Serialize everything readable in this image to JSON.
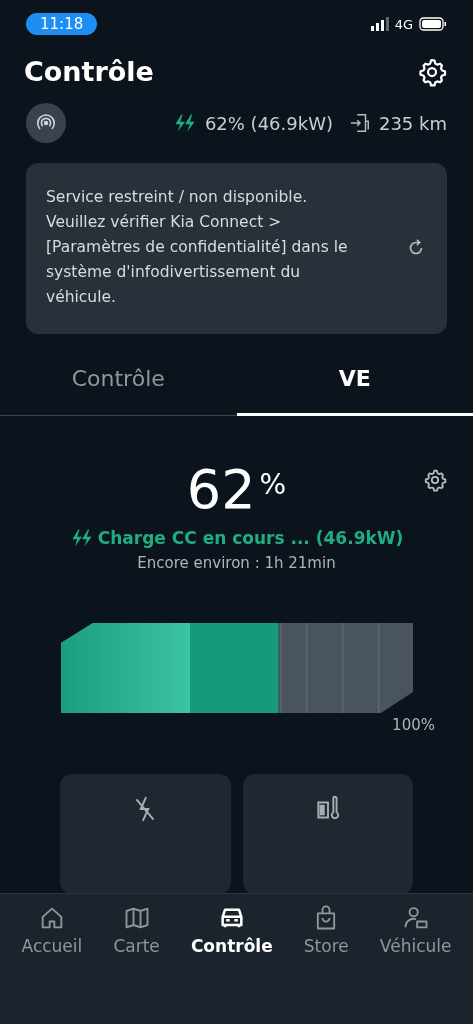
{
  "status_bar": {
    "time": "11:18",
    "network": "4G"
  },
  "header": {
    "title": "Contrôle"
  },
  "summary": {
    "charge": "62% (46.9kW)",
    "range": "235 km"
  },
  "notice": {
    "text": "Service restreint / non disponible. Veuillez vérifier Kia Connect > [Paramètres de confidentialité] dans le système d'infodivertissement du véhicule."
  },
  "tabs": [
    {
      "label": "Contrôle",
      "selected": false
    },
    {
      "label": "VE",
      "selected": true
    }
  ],
  "ev": {
    "percent": "62",
    "unit": "%",
    "status": "Charge CC en cours ... (46.9kW)",
    "remaining": "Encore environ : 1h 21min",
    "battery": {
      "level": 0.62,
      "max_label": "100%"
    }
  },
  "nav": [
    {
      "label": "Accueil",
      "selected": false
    },
    {
      "label": "Carte",
      "selected": false
    },
    {
      "label": "Contrôle",
      "selected": true
    },
    {
      "label": "Store",
      "selected": false
    },
    {
      "label": "Véhicule",
      "selected": false
    }
  ]
}
